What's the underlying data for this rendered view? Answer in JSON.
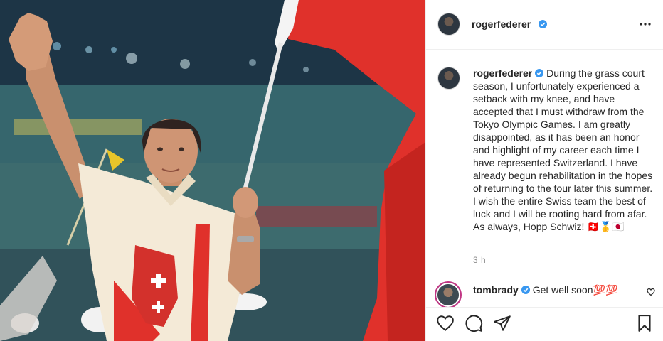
{
  "post": {
    "author": "rogerfederer",
    "verified": true,
    "caption": "During the grass court season, I unfortunately experienced a setback with my knee, and have accepted that I must withdraw from the Tokyo Olympic Games. I am greatly disappointed, as it has been an honor and highlight of my career each time I have represented Switzerland. I have already begun rehabilitation in the hopes of returning to the tour later this summer. I wish the entire Swiss team the best of luck and I will be rooting hard from afar. As always, Hopp Schwiz! 🇨🇭🥇🇯🇵",
    "time": "3 h"
  },
  "comment": {
    "author": "tombrady",
    "verified": true,
    "text": "Get well soon💯💯"
  },
  "icons": {
    "more": "more-options-icon",
    "verified": "verified-badge-icon",
    "like": "heart-icon",
    "comment": "comment-icon",
    "share": "share-icon",
    "save": "bookmark-icon"
  },
  "colors": {
    "verified_blue": "#3897f0",
    "text": "#262626",
    "muted": "#8e8e8e",
    "flag_red": "#e0312b",
    "story_ring": "#c13584"
  }
}
